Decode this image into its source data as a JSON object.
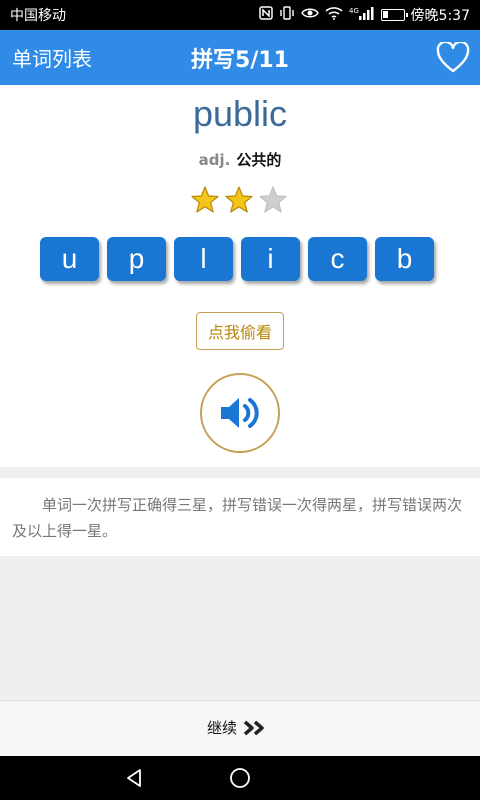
{
  "status_bar": {
    "carrier": "中国移动",
    "time": "傍晚5:37",
    "network_label": "4G",
    "icons": [
      "nfc-icon",
      "vibrate-icon",
      "eye-icon",
      "wifi-icon",
      "signal-icon",
      "battery-icon"
    ],
    "battery_level": 0.25
  },
  "header": {
    "left_label": "单词列表",
    "title": "拼写5/11",
    "background": "#2f8be6",
    "right_icon": "heart-outline-icon"
  },
  "word": {
    "text": "public",
    "pos": "adj.",
    "meaning": "公共的",
    "rating": 2,
    "max_rating": 3
  },
  "letters": [
    "u",
    "p",
    "l",
    "i",
    "c",
    "b"
  ],
  "peek_button": "点我偷看",
  "speaker_icon": "speaker-icon",
  "hint": "单词一次拼写正确得三星，拼写错误一次得两星，拼写错误两次及以上得一星。",
  "continue_button": {
    "label": "继续",
    "icon": "double-chevron-right-icon"
  },
  "nav": {
    "icons": [
      "back-triangle-icon",
      "home-circle-icon"
    ]
  },
  "colors": {
    "accent": "#2f8be6",
    "letter_tile": "#1976d2",
    "gold": "#c9a057",
    "word": "#3a6a9a"
  }
}
